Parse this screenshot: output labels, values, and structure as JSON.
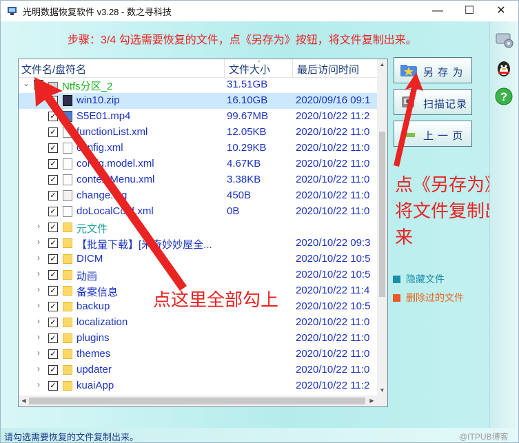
{
  "window": {
    "title": "光明数据恢复软件 v3.28 - 数之寻科技",
    "minimize_glyph": "—",
    "maximize_glyph": "☐",
    "close_glyph": "✕"
  },
  "step_text": "步骤：3/4 勾选需要恢复的文件，点《另存为》按钮，将文件复制出来。",
  "table": {
    "headers": {
      "name": "文件名/盘符名",
      "size": "文件大小",
      "time": "最后访问时间"
    },
    "rows": [
      {
        "name": "Ntfs分区_2",
        "size": "31.51GB",
        "time": "",
        "icon": "drive-icon",
        "level": 0,
        "expander": "⌄",
        "checked": "✓",
        "style": "green"
      },
      {
        "name": "win10.zip",
        "size": "16.10GB",
        "time": "2020/09/16 09:1",
        "icon": "zip-icon",
        "level": 1,
        "expander": "",
        "checked": "✓",
        "style": "sel"
      },
      {
        "name": "S5E01.mp4",
        "size": "99.67MB",
        "time": "2020/10/22 11:2",
        "icon": "video-file-icon",
        "level": 1,
        "expander": "",
        "checked": "✓",
        "style": ""
      },
      {
        "name": "functionList.xml",
        "size": "12.05KB",
        "time": "2020/10/22 11:0",
        "icon": "file-icon",
        "level": 1,
        "expander": "",
        "checked": "✓",
        "style": ""
      },
      {
        "name": "config.xml",
        "size": "10.29KB",
        "time": "2020/10/22 11:0",
        "icon": "file-icon",
        "level": 1,
        "expander": "",
        "checked": "✓",
        "style": ""
      },
      {
        "name": "config.model.xml",
        "size": "4.67KB",
        "time": "2020/10/22 11:0",
        "icon": "file-icon",
        "level": 1,
        "expander": "",
        "checked": "✓",
        "style": ""
      },
      {
        "name": "contextMenu.xml",
        "size": "3.38KB",
        "time": "2020/10/22 11:0",
        "icon": "file-icon",
        "level": 1,
        "expander": "",
        "checked": "✓",
        "style": ""
      },
      {
        "name": "change.log",
        "size": "450B",
        "time": "2020/10/22 11:0",
        "icon": "text-file-icon",
        "level": 1,
        "expander": "",
        "checked": "✓",
        "style": ""
      },
      {
        "name": "doLocalConf.xml",
        "size": "0B",
        "time": "2020/10/22 11:0",
        "icon": "file-icon",
        "level": 1,
        "expander": "",
        "checked": "✓",
        "style": ""
      },
      {
        "name": "元文件",
        "size": "",
        "time": "",
        "icon": "folder-icon",
        "level": 1,
        "expander": "›",
        "checked": "✓",
        "style": "teal"
      },
      {
        "name": "【批量下载】[米奇妙妙屋全...",
        "size": "",
        "time": "2020/10/22 09:3",
        "icon": "folder-icon",
        "level": 1,
        "expander": "›",
        "checked": "✓",
        "style": ""
      },
      {
        "name": "DICM",
        "size": "",
        "time": "2020/10/22 10:5",
        "icon": "folder-icon",
        "level": 1,
        "expander": "›",
        "checked": "✓",
        "style": ""
      },
      {
        "name": "动画",
        "size": "",
        "time": "2020/10/22 10:5",
        "icon": "folder-icon",
        "level": 1,
        "expander": "›",
        "checked": "✓",
        "style": ""
      },
      {
        "name": "备案信息",
        "size": "",
        "time": "2020/10/22 11:4",
        "icon": "folder-icon",
        "level": 1,
        "expander": "›",
        "checked": "✓",
        "style": ""
      },
      {
        "name": "backup",
        "size": "",
        "time": "2020/10/22 10:5",
        "icon": "folder-icon",
        "level": 1,
        "expander": "›",
        "checked": "✓",
        "style": ""
      },
      {
        "name": "localization",
        "size": "",
        "time": "2020/10/22 11:0",
        "icon": "folder-icon",
        "level": 1,
        "expander": "›",
        "checked": "✓",
        "style": ""
      },
      {
        "name": "plugins",
        "size": "",
        "time": "2020/10/22 11:0",
        "icon": "folder-icon",
        "level": 1,
        "expander": "›",
        "checked": "✓",
        "style": ""
      },
      {
        "name": "themes",
        "size": "",
        "time": "2020/10/22 11:0",
        "icon": "folder-icon",
        "level": 1,
        "expander": "›",
        "checked": "✓",
        "style": ""
      },
      {
        "name": "updater",
        "size": "",
        "time": "2020/10/22 11:0",
        "icon": "folder-icon",
        "level": 1,
        "expander": "›",
        "checked": "✓",
        "style": ""
      },
      {
        "name": "kuaiApp",
        "size": "",
        "time": "2020/10/22 11:2",
        "icon": "folder-icon",
        "level": 1,
        "expander": "›",
        "checked": "✓",
        "style": ""
      }
    ]
  },
  "buttons": {
    "save_as": "另 存 为",
    "scan_record": "扫描记录",
    "prev_page": "上 一 页"
  },
  "legend": {
    "hidden": "隐藏文件",
    "deleted": "删除过的文件",
    "hidden_color": "#1b8fa8",
    "deleted_color": "#e8582a"
  },
  "annotations": {
    "save_note": "点《另存为》，将文件复制出来",
    "check_note": "点这里全部勾上",
    "color": "#ea2323"
  },
  "status": "请勾选需要恢复的文件复制出来。",
  "watermark": "@ITPUB博客"
}
